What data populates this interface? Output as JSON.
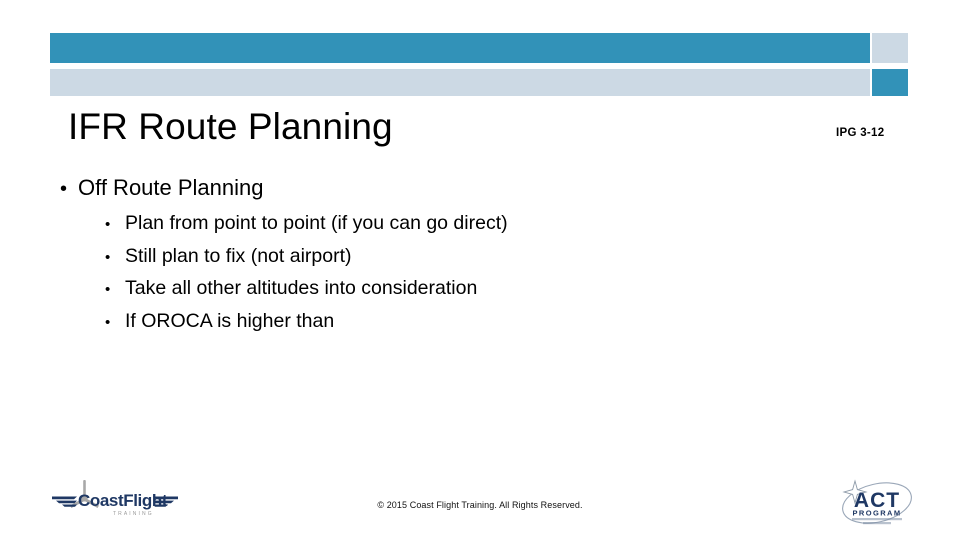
{
  "slide": {
    "title": "IFR Route Planning",
    "page_reference": "IPG 3-12",
    "copyright": "© 2015 Coast Flight Training. All Rights Reserved.",
    "colors": {
      "accent_blue": "#3292b8",
      "accent_light": "#ccd9e4",
      "text": "#000000",
      "logo_navy": "#1f3864",
      "logo_gray": "#9a9a9a"
    },
    "header_bars": [
      {
        "name": "top-row",
        "long": "#3292b8",
        "square": "#ccd9e4"
      },
      {
        "name": "bottom-row",
        "long": "#ccd9e4",
        "square": "#3292b8"
      }
    ],
    "content": {
      "bullets": [
        {
          "marker": "•",
          "text": "Off Route Planning",
          "children": [
            {
              "marker": "•",
              "text": "Plan from point to point (if you can go direct)"
            },
            {
              "marker": "•",
              "text": "Still plan to fix (not airport)"
            },
            {
              "marker": "•",
              "text": "Take all other altitudes into consideration"
            },
            {
              "marker": "•",
              "text": "If OROCA is higher than"
            }
          ]
        }
      ]
    },
    "logos": {
      "coast_flight": {
        "name": "coastflight-logo",
        "primary_text": "CoastFlight",
        "sub_text": "T R A I N I N G"
      },
      "act": {
        "name": "act-program-logo",
        "primary_text": "ACT",
        "sub_text": "PROGRAM"
      }
    }
  }
}
